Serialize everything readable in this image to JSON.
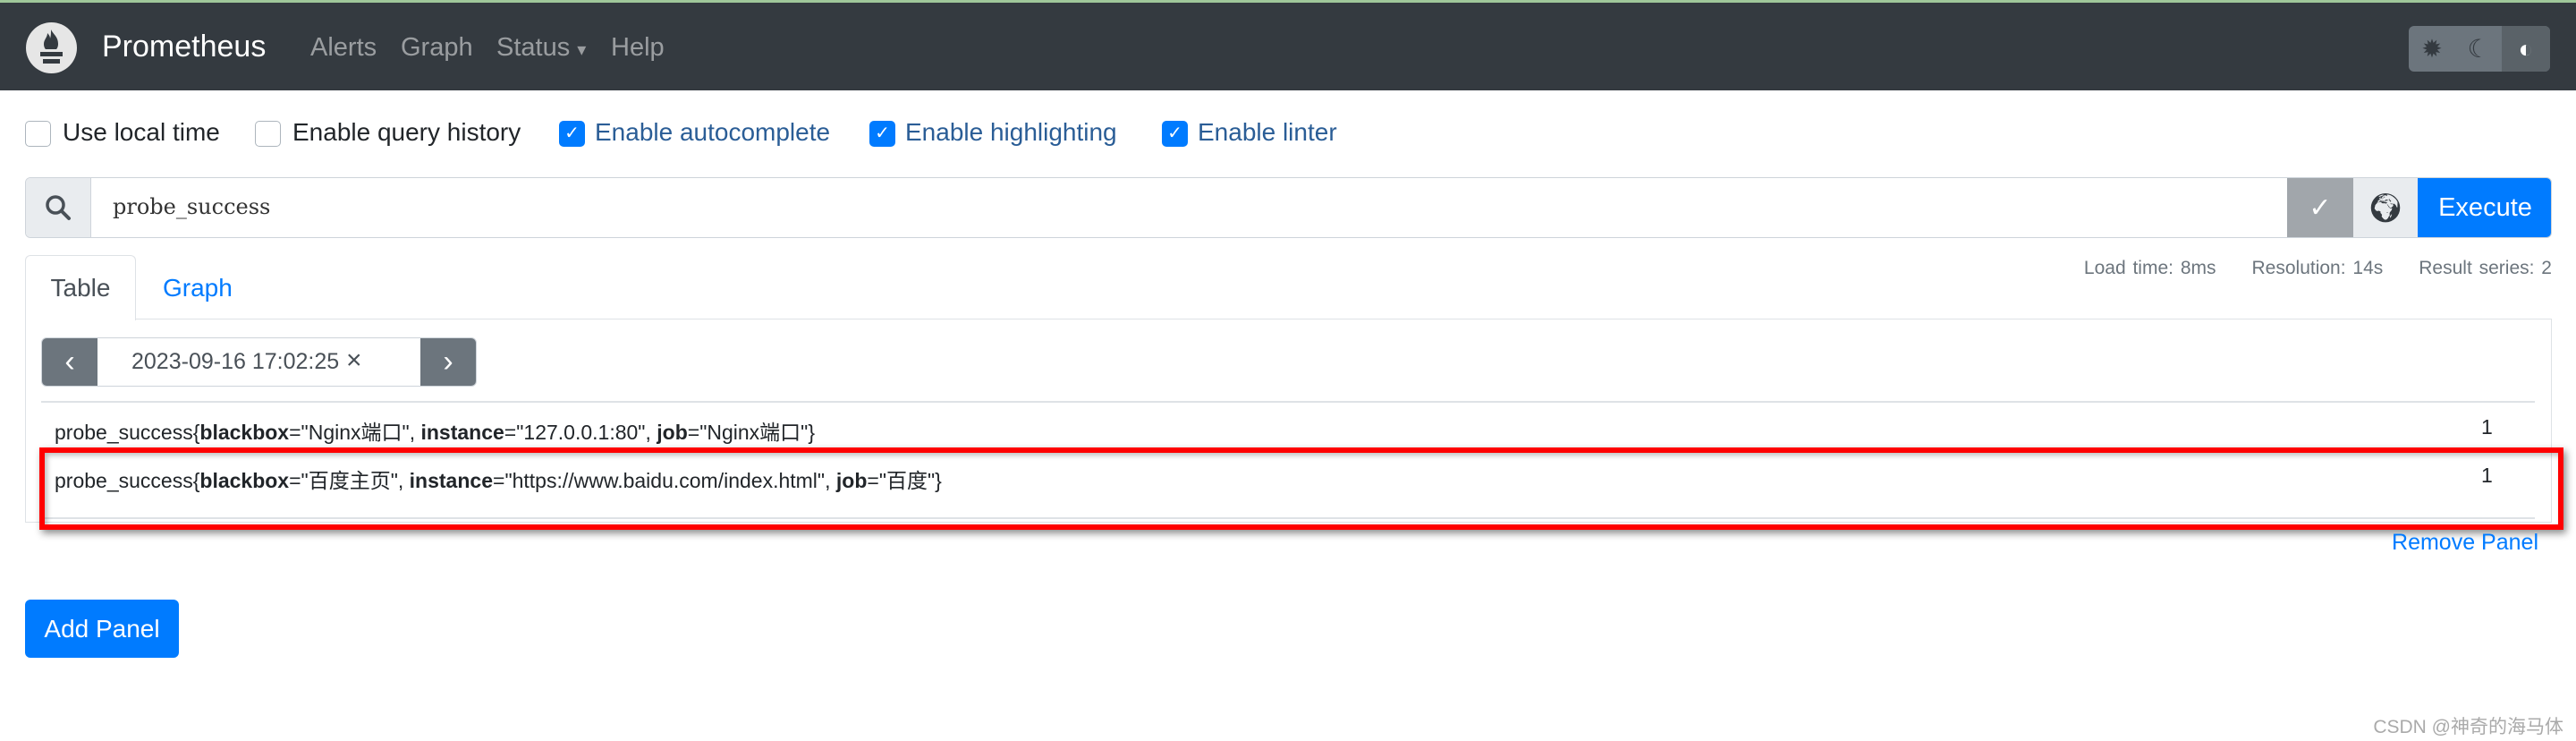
{
  "navbar": {
    "brand": "Prometheus",
    "links": [
      "Alerts",
      "Graph",
      "Status",
      "Help"
    ],
    "status_caret": "▾",
    "theme_icons": [
      "sun-icon",
      "moon-icon",
      "contrast-icon"
    ]
  },
  "options": [
    {
      "label": "Use local time",
      "checked": false
    },
    {
      "label": "Enable query history",
      "checked": false
    },
    {
      "label": "Enable autocomplete",
      "checked": true
    },
    {
      "label": "Enable highlighting",
      "checked": true
    },
    {
      "label": "Enable linter",
      "checked": true
    }
  ],
  "query": {
    "value": "probe_success",
    "execute_label": "Execute"
  },
  "stats": {
    "load_time": "Load time: 8ms",
    "resolution": "Resolution: 14s",
    "result_series": "Result series: 2"
  },
  "tabs": {
    "table": "Table",
    "graph": "Graph"
  },
  "time_picker": {
    "value": "2023-09-16 17:02:25",
    "clear": "×"
  },
  "results": [
    {
      "metric": "probe_success",
      "labels": [
        {
          "k": "blackbox",
          "v": "\"Nginx端口\""
        },
        {
          "k": "instance",
          "v": "\"127.0.0.1:80\""
        },
        {
          "k": "job",
          "v": "\"Nginx端口\""
        }
      ],
      "value": "1"
    },
    {
      "metric": "probe_success",
      "labels": [
        {
          "k": "blackbox",
          "v": "\"百度主页\""
        },
        {
          "k": "instance",
          "v": "\"https://www.baidu.com/index.html\""
        },
        {
          "k": "job",
          "v": "\"百度\""
        }
      ],
      "value": "1"
    }
  ],
  "highlight_color": "#ff0000",
  "remove_panel": "Remove Panel",
  "add_panel": "Add Panel",
  "watermark": "CSDN @神奇的海马体"
}
